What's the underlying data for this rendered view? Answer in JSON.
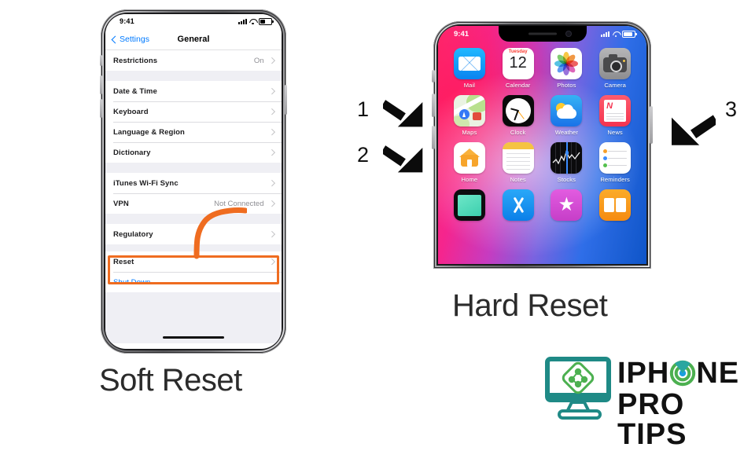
{
  "page": {
    "background": "#ffffff",
    "highlight_color": "#ef6c20"
  },
  "soft_reset": {
    "caption": "Soft Reset",
    "status_bar": {
      "time": "9:41",
      "signal": "signal-bars-icon",
      "wifi": "wifi-icon",
      "battery": "battery-icon"
    },
    "navbar": {
      "back_label": "Settings",
      "title": "General"
    },
    "groups": [
      {
        "rows": [
          {
            "label": "Restrictions",
            "value": "On",
            "chevron": true
          }
        ]
      },
      {
        "rows": [
          {
            "label": "Date & Time",
            "value": "",
            "chevron": true
          },
          {
            "label": "Keyboard",
            "value": "",
            "chevron": true
          },
          {
            "label": "Language & Region",
            "value": "",
            "chevron": true
          },
          {
            "label": "Dictionary",
            "value": "",
            "chevron": true
          }
        ]
      },
      {
        "rows": [
          {
            "label": "iTunes Wi-Fi Sync",
            "value": "",
            "chevron": true
          },
          {
            "label": "VPN",
            "value": "Not Connected",
            "chevron": true
          }
        ]
      },
      {
        "rows": [
          {
            "label": "Regulatory",
            "value": "",
            "chevron": true
          }
        ]
      },
      {
        "rows": [
          {
            "label": "Reset",
            "value": "",
            "chevron": true,
            "highlighted": true
          }
        ]
      },
      {
        "rows": [
          {
            "label": "Shut Down",
            "value": "",
            "chevron": false,
            "link": true
          }
        ]
      }
    ]
  },
  "hard_reset": {
    "caption": "Hard Reset",
    "status_bar": {
      "time": "9:41",
      "signal": "signal-bars-icon",
      "wifi": "wifi-icon",
      "battery": "battery-icon"
    },
    "apps": [
      {
        "name": "Mail",
        "icon": "mail-icon"
      },
      {
        "name": "Calendar",
        "icon": "calendar-icon",
        "weekday": "Tuesday",
        "day": "12"
      },
      {
        "name": "Photos",
        "icon": "photos-icon"
      },
      {
        "name": "Camera",
        "icon": "camera-icon"
      },
      {
        "name": "Maps",
        "icon": "maps-icon"
      },
      {
        "name": "Clock",
        "icon": "clock-icon"
      },
      {
        "name": "Weather",
        "icon": "weather-icon"
      },
      {
        "name": "News",
        "icon": "news-icon",
        "glyph": "N"
      },
      {
        "name": "Home",
        "icon": "home-icon"
      },
      {
        "name": "Notes",
        "icon": "notes-icon"
      },
      {
        "name": "Stocks",
        "icon": "stocks-icon"
      },
      {
        "name": "Reminders",
        "icon": "reminders-icon"
      },
      {
        "name": "",
        "icon": "tv-icon"
      },
      {
        "name": "",
        "icon": "app-store-icon"
      },
      {
        "name": "",
        "icon": "itunes-store-icon",
        "glyph": "★"
      },
      {
        "name": "",
        "icon": "ibooks-icon"
      }
    ],
    "steps": [
      {
        "number": "1",
        "target": "volume-up-button"
      },
      {
        "number": "2",
        "target": "volume-down-button"
      },
      {
        "number": "3",
        "target": "side-power-button"
      }
    ]
  },
  "logo": {
    "line1": "IPH",
    "line1_o": "O",
    "line1_end": "NE",
    "line2": "PRO TIPS",
    "monitor_icon": "imac-monitor-icon",
    "teal": "#1f8a86",
    "green": "#4cb050"
  }
}
